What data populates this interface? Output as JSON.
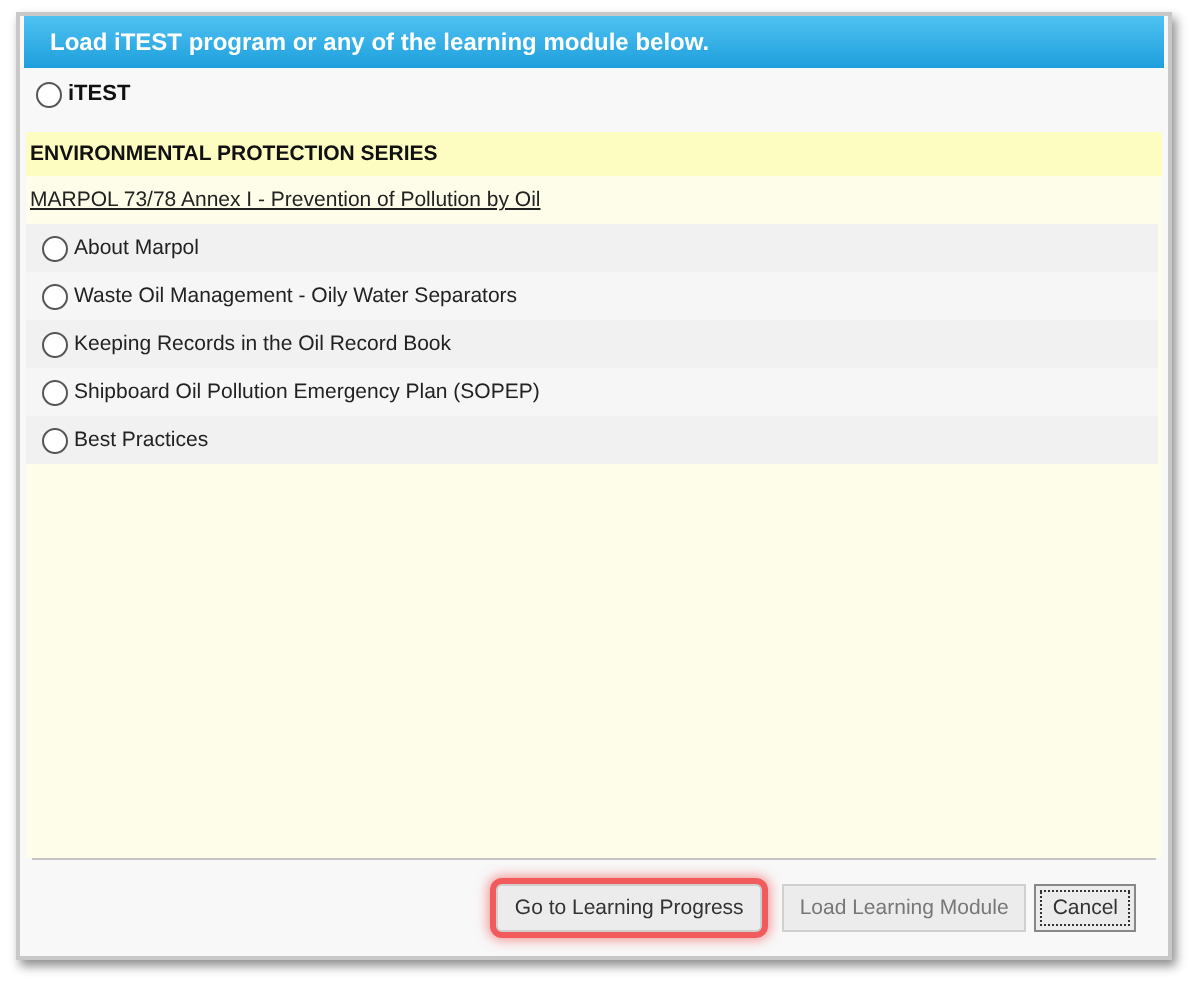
{
  "dialog": {
    "title": "Load iTEST program or any of the learning module below."
  },
  "program": {
    "label": "iTEST",
    "selected": false
  },
  "series": {
    "title": "ENVIRONMENTAL PROTECTION SERIES",
    "course": "MARPOL 73/78 Annex I - Prevention of Pollution by Oil",
    "modules": [
      {
        "label": "About Marpol",
        "selected": false
      },
      {
        "label": "Waste Oil Management - Oily Water Separators",
        "selected": false
      },
      {
        "label": "Keeping Records in the Oil Record Book",
        "selected": false
      },
      {
        "label": "Shipboard Oil Pollution Emergency Plan (SOPEP)",
        "selected": false
      },
      {
        "label": "Best Practices",
        "selected": false
      }
    ]
  },
  "buttons": [
    {
      "label": "Go to Learning Progress",
      "highlighted": true,
      "disabled": false,
      "focused": false
    },
    {
      "label": "Load Learning Module",
      "highlighted": false,
      "disabled": true,
      "focused": false
    },
    {
      "label": "Cancel",
      "highlighted": false,
      "disabled": false,
      "focused": true
    }
  ]
}
